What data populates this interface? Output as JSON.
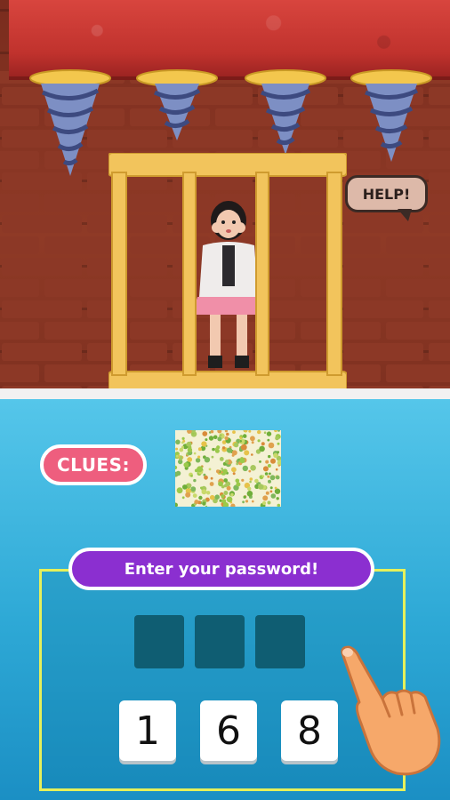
{
  "scene": {
    "help_text": "HELP!"
  },
  "clues": {
    "label": "CLUES:"
  },
  "password": {
    "title": "Enter your password!",
    "slots": [
      "",
      "",
      ""
    ],
    "keys": [
      "1",
      "6",
      "8"
    ]
  },
  "colors": {
    "ceiling": "#c0322d",
    "cage": "#f2c45c",
    "clues_badge": "#ee5e7e",
    "title_pill": "#8b2fd0",
    "panel_border": "#e6f05a",
    "slot": "#0f5d72"
  },
  "icons": {
    "drill": "drill-icon",
    "hand": "pointing-hand-icon"
  }
}
